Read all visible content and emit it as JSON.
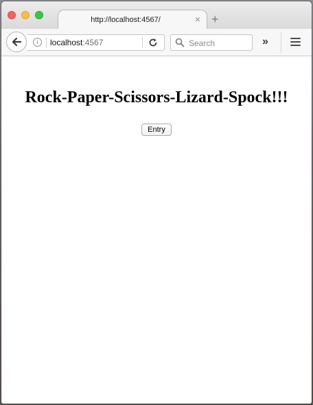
{
  "browser": {
    "tab": {
      "title": "http://localhost:4567/",
      "close_glyph": "×"
    },
    "new_tab_glyph": "+",
    "urlbar": {
      "host": "localhost",
      "port": ":4567"
    },
    "search": {
      "placeholder": "Search"
    },
    "overflow_glyph": "»",
    "icons": {
      "back": "back-arrow-icon",
      "info": "info-icon",
      "reload": "reload-icon",
      "search": "search-icon",
      "menu": "hamburger-menu-icon"
    }
  },
  "page": {
    "title": "Rock-Paper-Scissors-Lizard-Spock!!!",
    "entry_button_label": "Entry"
  }
}
